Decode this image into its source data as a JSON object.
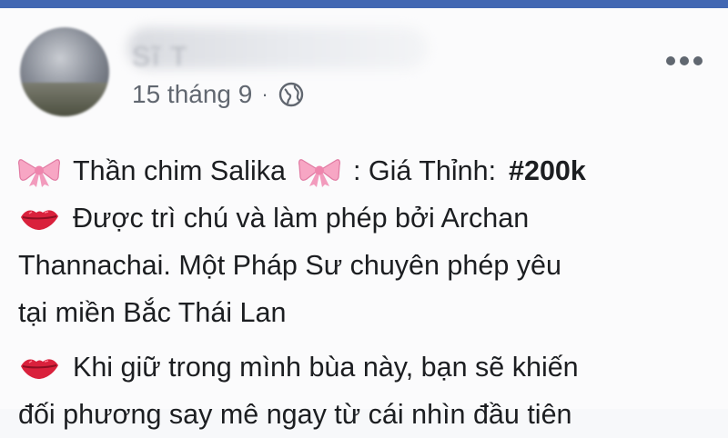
{
  "header": {
    "name": "Sĩ T",
    "date": "15 tháng 9",
    "separator": "·",
    "privacy_icon": "globe-icon",
    "more_icon": "more-horizontal-icon"
  },
  "post": {
    "line1_a": "Thần chim Salika",
    "line1_b": ": Giá Thỉnh:",
    "hashtag": "#200k",
    "para2_l1": "Được trì chú và làm phép bởi Archan",
    "para2_l2": "Thannachai. Một Pháp Sư chuyên phép yêu",
    "para2_l3": "tại miền Bắc Thái Lan",
    "para3_l1": "Khi giữ trong mình bùa này, bạn sẽ khiến",
    "para3_l2": "đối phương say mê ngay từ cái nhìn đầu tiên",
    "emojis": [
      "ribbon-emoji",
      "kiss-lips-emoji"
    ]
  },
  "colors": {
    "brand": "#4267b2",
    "ribbon": "#f7a6c4",
    "lips": "#d9213c",
    "meta_text": "#616770"
  }
}
